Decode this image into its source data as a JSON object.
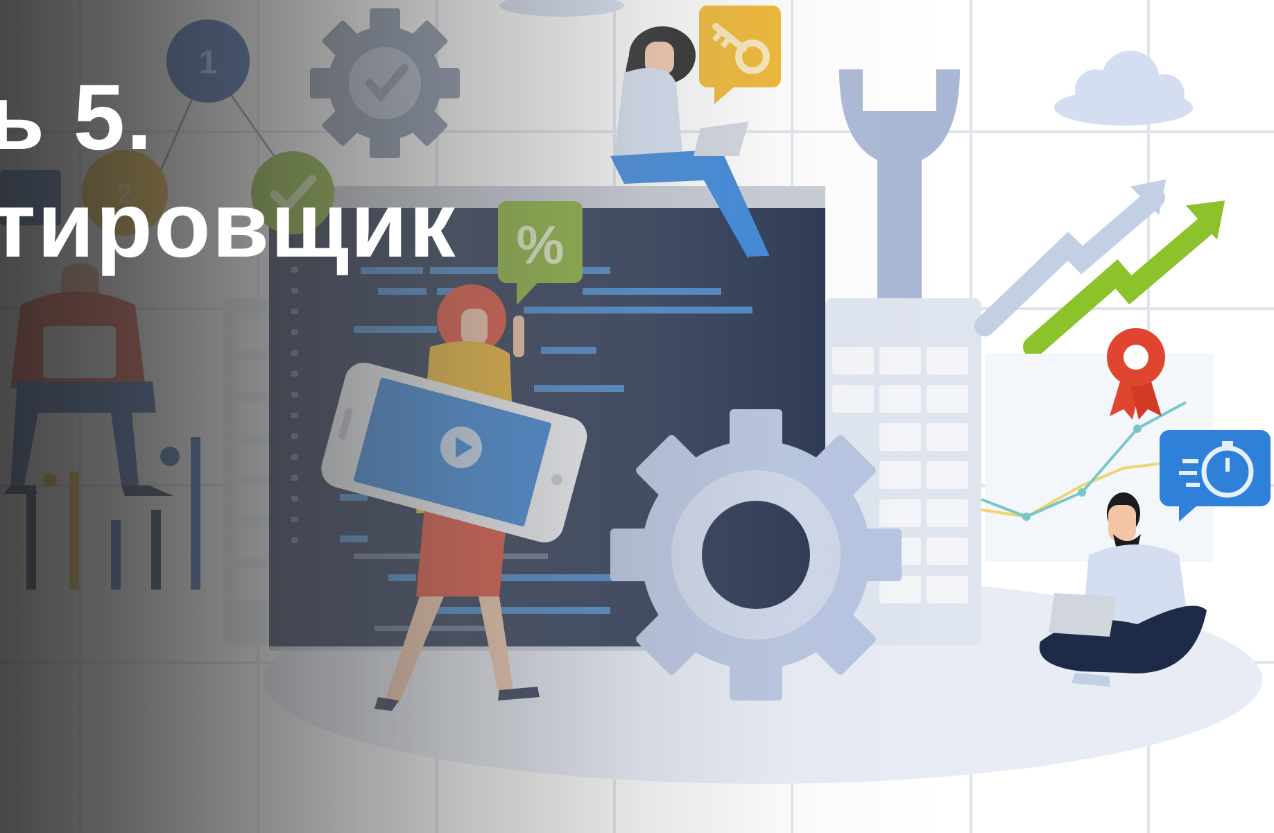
{
  "title": {
    "line1": "ь 5.",
    "line2": "тировщик"
  },
  "illustration": {
    "badges": {
      "number_one": "1",
      "number_two": "2",
      "discount": "%"
    },
    "icons": [
      "key-icon",
      "gear-icon",
      "wrench-icon",
      "stopwatch-icon",
      "award-icon",
      "play-icon",
      "check-icon",
      "cloud-icon",
      "trend-arrow-icon",
      "laptop-icon"
    ]
  },
  "colors": {
    "dark_overlay": "#2d2d2d",
    "screen_navy": "#1e2b48",
    "code_blue": "#3b7fc4",
    "gear_lavender": "#b5c3e0",
    "accent_yellow": "#efb325",
    "accent_green": "#83ad2c",
    "accent_red": "#e0452f",
    "icon_blue": "#2f80d8",
    "badge_navy": "#2e5aa6"
  }
}
